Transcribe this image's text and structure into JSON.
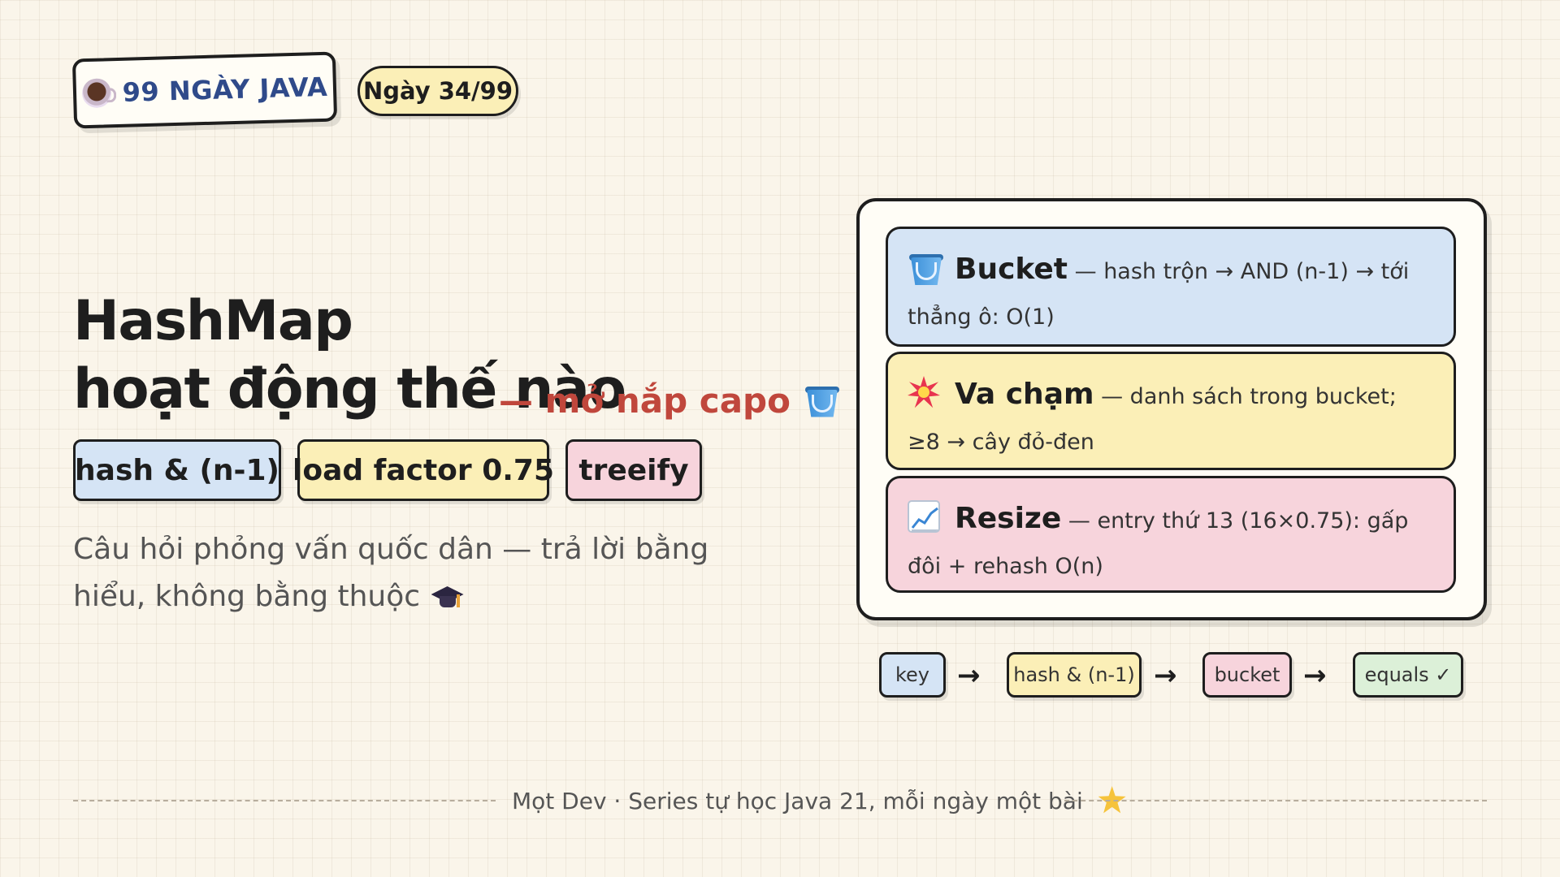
{
  "brand": {
    "label": "99 NGÀY JAVA",
    "icon": "coffee-icon"
  },
  "day_badge": "Ngày 34/99",
  "title": {
    "line1": "HashMap",
    "line2": "hoạt động thế nào",
    "subtitle": "— mở nắp capo",
    "subtitle_icon": "bucket-icon"
  },
  "tags": [
    {
      "label": "hash & (n-1)",
      "color": "#d5e4f5"
    },
    {
      "label": "load factor 0.75",
      "color": "#fbefb7"
    },
    {
      "label": "treeify",
      "color": "#f7d4dc"
    }
  ],
  "description": {
    "text": "Câu hỏi phỏng vấn quốc dân — trả lời bằng hiểu, không bằng thuộc",
    "icon": "graduation-cap-icon"
  },
  "cards": [
    {
      "icon": "bucket-icon",
      "title": "Bucket",
      "text": "— hash trộn → AND (n-1) → tới thẳng ô: O(1)",
      "color": "#d5e4f5"
    },
    {
      "icon": "collision-icon",
      "title": "Va chạm",
      "text": "— danh sách trong bucket; ≥8 → cây đỏ-đen",
      "color": "#fbefb7"
    },
    {
      "icon": "chart-increasing-icon",
      "title": "Resize",
      "text": "— entry thứ 13 (16×0.75): gấp đôi + rehash O(n)",
      "color": "#f7d4dc"
    }
  ],
  "flow": {
    "steps": [
      "key",
      "hash & (n-1)",
      "bucket",
      "equals ✓"
    ],
    "arrow": "→"
  },
  "footer": {
    "text": "Mọt Dev · Series tự học Java 21, mỗi ngày một bài",
    "icon": "star-icon"
  }
}
